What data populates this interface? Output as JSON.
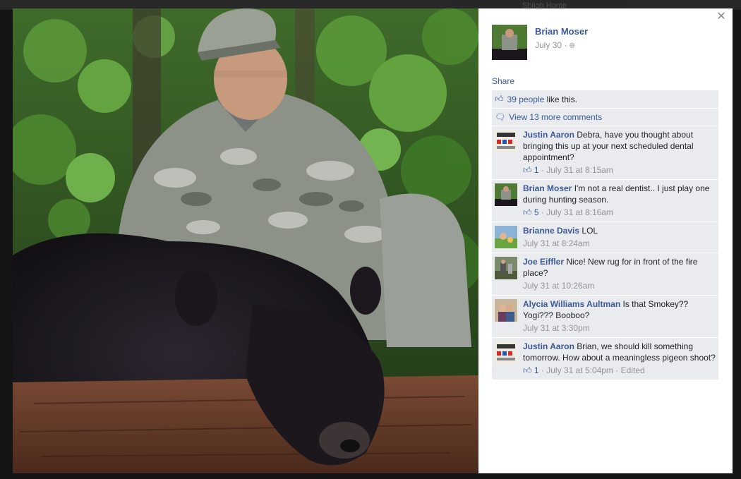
{
  "backdrop": {
    "text": "Shiloh   Home"
  },
  "post": {
    "author": "Brian Moser",
    "date": "July 30 ·",
    "privacy_icon": "globe-icon"
  },
  "actions": {
    "share_label": "Share"
  },
  "likes": {
    "count_text": "39 people",
    "suffix": " like this."
  },
  "view_more": {
    "label": "View 13 more comments"
  },
  "comments": [
    {
      "author": "Justin Aaron",
      "text": "Debra, have you thought about bringing this up at your next scheduled dental appointment?",
      "likes": "1",
      "time": "July 31 at 8:15am",
      "edited": ""
    },
    {
      "author": "Brian Moser",
      "text": "I'm not a real dentist.. I just play one during hunting season.",
      "likes": "5",
      "time": "July 31 at 8:16am",
      "edited": ""
    },
    {
      "author": "Brianne Davis",
      "text": "LOL",
      "likes": "",
      "time": "July 31 at 8:24am",
      "edited": ""
    },
    {
      "author": "Joe Eiffler",
      "text": "Nice! New rug for in front of the fire place?",
      "likes": "",
      "time": "July 31 at 10:26am",
      "edited": ""
    },
    {
      "author": "Alycia Williams Aultman",
      "text": "Is that Smokey?? Yogi??? Booboo?",
      "likes": "",
      "time": "July 31 at 3:30pm",
      "edited": ""
    },
    {
      "author": "Justin Aaron",
      "text": "Brian, we should kill something tomorrow. How about a meaningless pigeon shoot?",
      "likes": "1",
      "time": "July 31 at 5:04pm",
      "edited": "· Edited"
    }
  ],
  "icons": {
    "close": "close-icon",
    "like": "thumbs-up-icon",
    "comment": "speech-bubble-icon"
  },
  "colors": {
    "link": "#3b5998",
    "meta": "#90949c",
    "row_bg": "#e9ebee"
  }
}
